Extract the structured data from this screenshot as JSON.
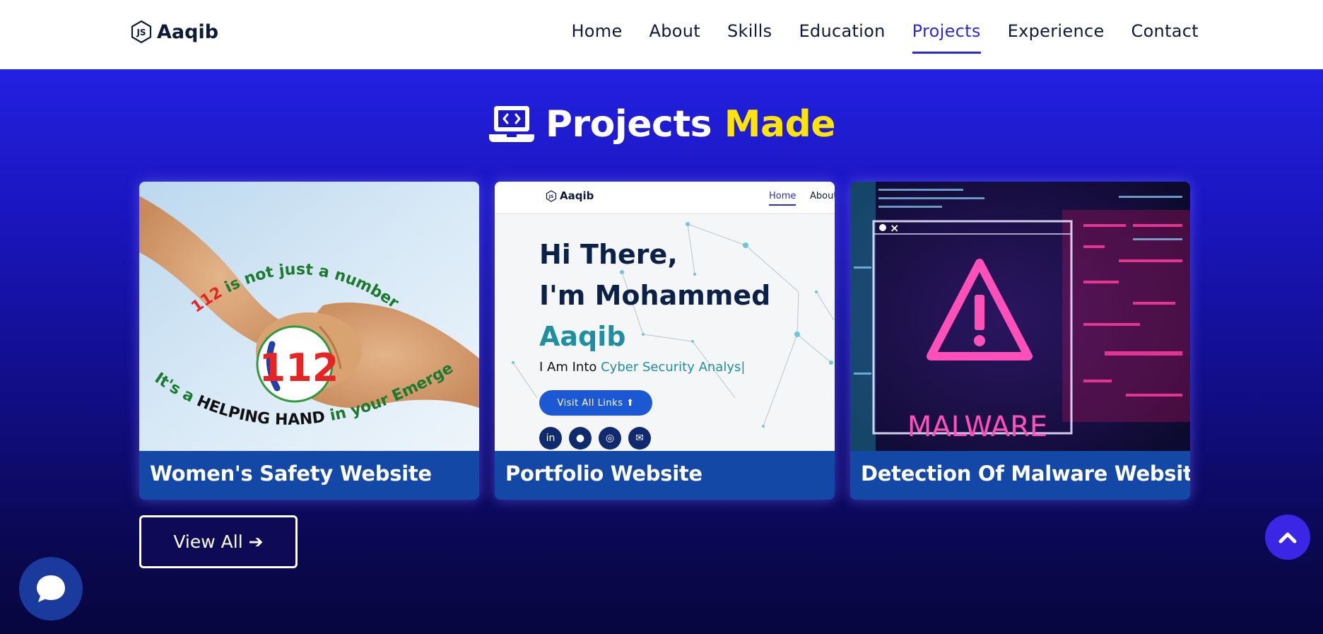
{
  "header": {
    "logo_text": "Aaqib",
    "nav": [
      {
        "label": "Home",
        "active": false
      },
      {
        "label": "About",
        "active": false
      },
      {
        "label": "Skills",
        "active": false
      },
      {
        "label": "Education",
        "active": false
      },
      {
        "label": "Projects",
        "active": true
      },
      {
        "label": "Experience",
        "active": false
      },
      {
        "label": "Contact",
        "active": false
      }
    ]
  },
  "section": {
    "title_main": "Projects",
    "title_accent": "Made",
    "icon": "laptop-code-icon"
  },
  "projects": [
    {
      "title": "Women's Safety Website",
      "image": {
        "top_text": "112 is not just a number",
        "top_text_red": "112",
        "top_text_rest": " is not just a number",
        "badge": "112",
        "bottom_text_a": "It's a ",
        "bottom_text_b": "HELPING HAND",
        "bottom_text_c": " in your Emergencies"
      }
    },
    {
      "title": "Portfolio Website",
      "image": {
        "logo": "Aaqib",
        "nav_home": "Home",
        "nav_about": "About",
        "hi": "Hi There,",
        "im": "I'm Mohammed",
        "name": "Aaqib",
        "into_prefix": "I Am Into ",
        "into_role": "Cyber Security Analys|",
        "button": "Visit All Links",
        "socials": [
          "linkedin-icon",
          "github-icon",
          "instagram-icon",
          "envelope-icon"
        ]
      }
    },
    {
      "title": "Detection Of Malware Website",
      "image": {
        "word": "MALWARE"
      }
    }
  ],
  "view_all_label": "View All",
  "colors": {
    "accent_yellow": "#ffe40a",
    "nav_active": "#2a2bd6",
    "card_footer": "#1448a6"
  }
}
